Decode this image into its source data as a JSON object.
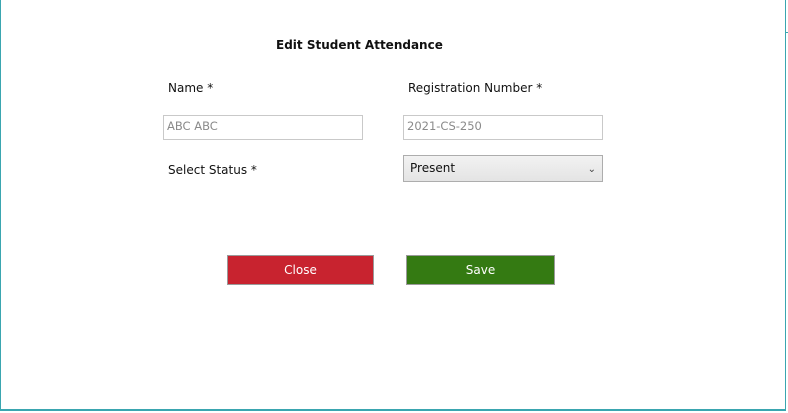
{
  "form": {
    "title": "Edit Student Attendance",
    "name_label": "Name *",
    "name_value": "ABC ABC",
    "registration_label": "Registration Number *",
    "registration_value": "2021-CS-250",
    "status_label": "Select Status *",
    "status_value": "Present"
  },
  "buttons": {
    "close_label": "Close",
    "save_label": "Save"
  },
  "colors": {
    "close_button": "#c8232f",
    "save_button": "#347a12",
    "window_border": "#3aa6b0"
  }
}
